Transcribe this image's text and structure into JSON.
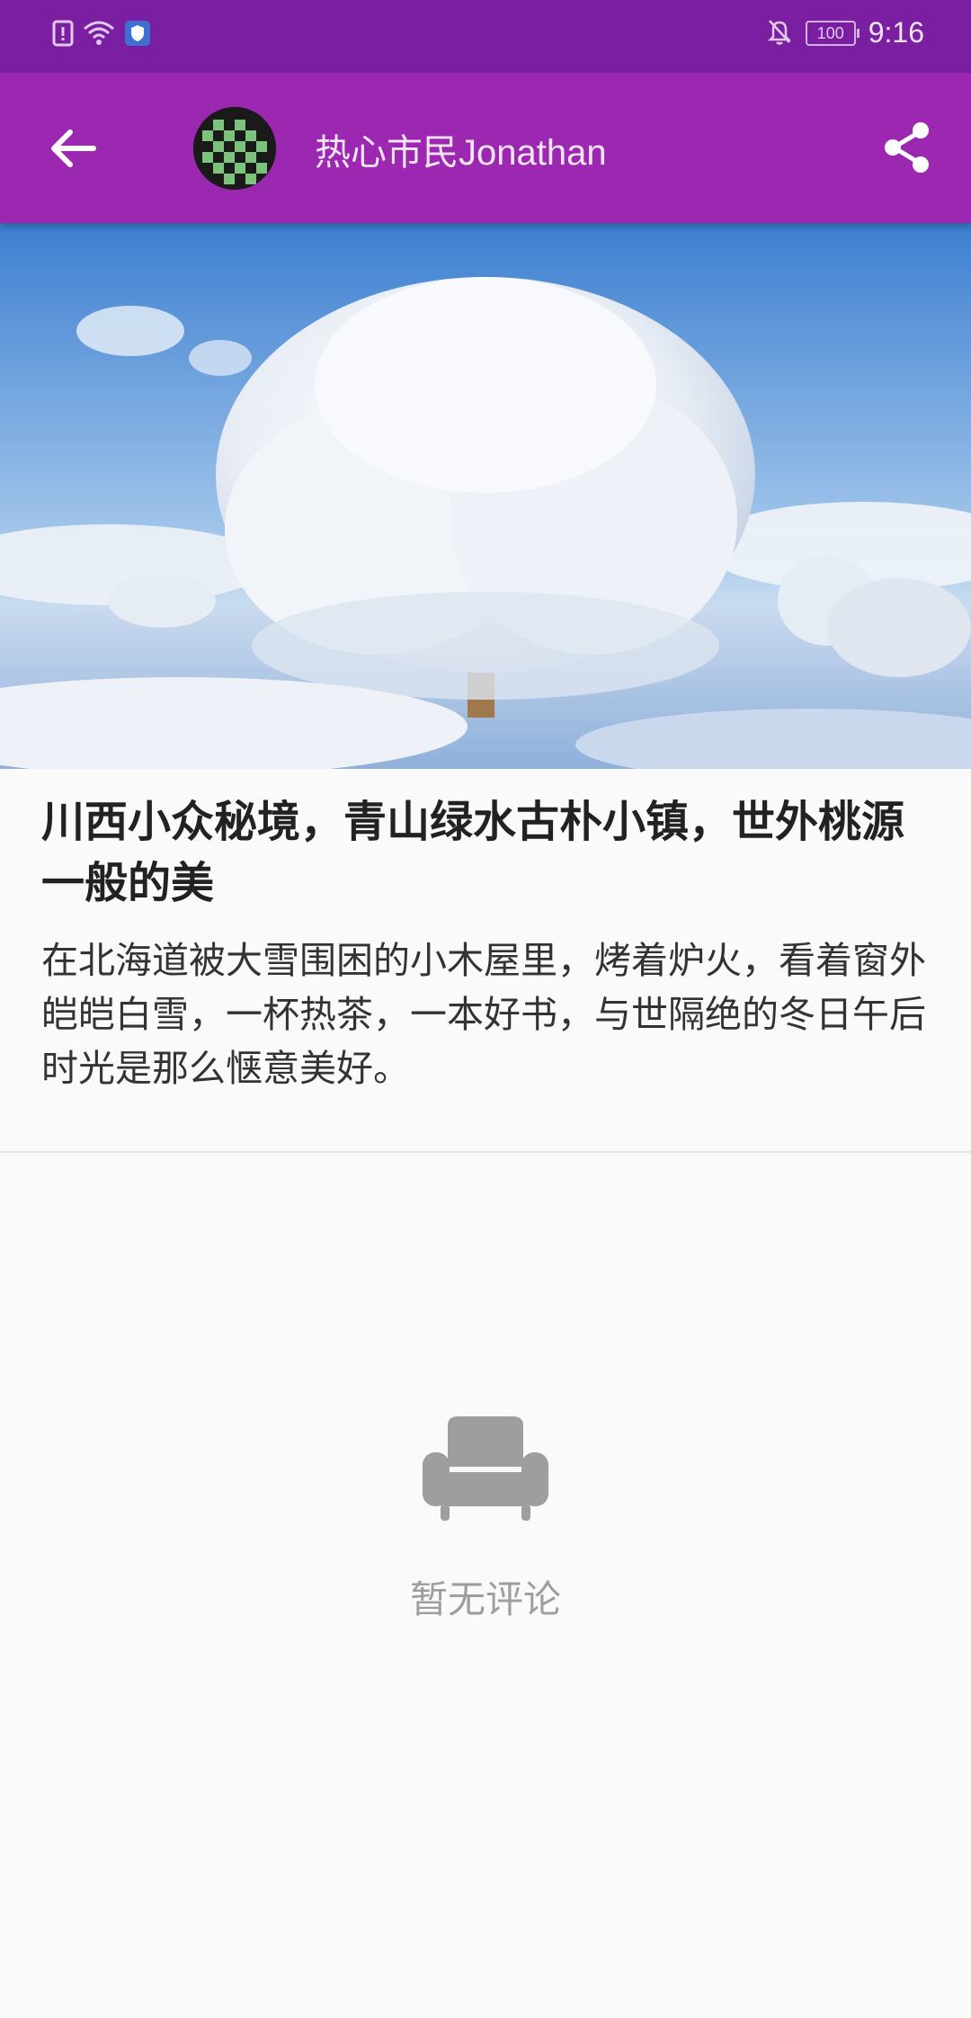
{
  "status_bar": {
    "time": "9:16",
    "battery": "100",
    "icons": [
      "sim-alert-icon",
      "wifi-icon",
      "shield-icon",
      "bell-off-icon",
      "battery-icon"
    ]
  },
  "app_bar": {
    "title": "热心市民Jonathan",
    "back_icon": "arrow-back-icon",
    "share_icon": "share-icon",
    "color": "#9c27b0"
  },
  "article": {
    "title": "川西小众秘境，青山绿水古朴小镇，世外桃源一般的美",
    "body": "在北海道被大雪围困的小木屋里，烤着炉火，看着窗外皑皑白雪，一杯热茶，一本好书，与世隔绝的冬日午后时光是那么惬意美好。"
  },
  "comments": {
    "empty_text": "暂无评论",
    "empty_icon": "sofa-icon"
  }
}
